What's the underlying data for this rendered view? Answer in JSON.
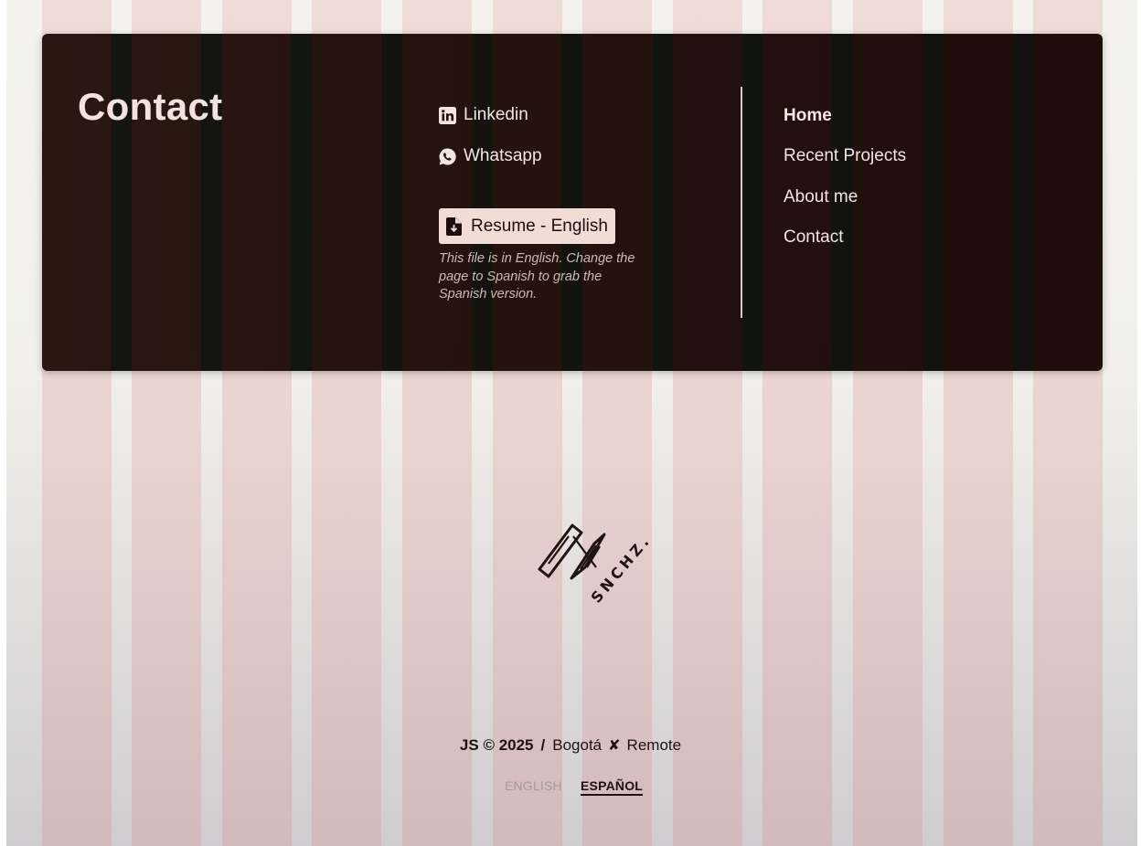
{
  "contact": {
    "title": "Contact",
    "links": [
      {
        "label": "Linkedin",
        "icon": "linkedin-icon"
      },
      {
        "label": "Whatsapp",
        "icon": "whatsapp-icon"
      }
    ],
    "resume": {
      "label": "Resume - English",
      "icon": "file-download-icon",
      "note": "This file is in English. Change the page to Spanish to grab the Spanish version."
    }
  },
  "nav": {
    "items": [
      "Home",
      "Recent Projects",
      "About me",
      "Contact"
    ],
    "active": "Home"
  },
  "logo": {
    "text": "SNCHZ."
  },
  "footer": {
    "copyright": "JS © 2025",
    "separator": "/",
    "location": "Bogotá",
    "mark": "✘",
    "mode": "Remote"
  },
  "languages": {
    "english": "ENGLISH",
    "spanish": "ESPAÑOL",
    "selected": "ESPAÑOL"
  },
  "colors": {
    "card_bg": "#24120f",
    "stripe_pink": "#efdbd7",
    "page_bg": "#f3f2ee",
    "accent_text": "#f3e3df",
    "resume_button": "#f2dcd6"
  }
}
